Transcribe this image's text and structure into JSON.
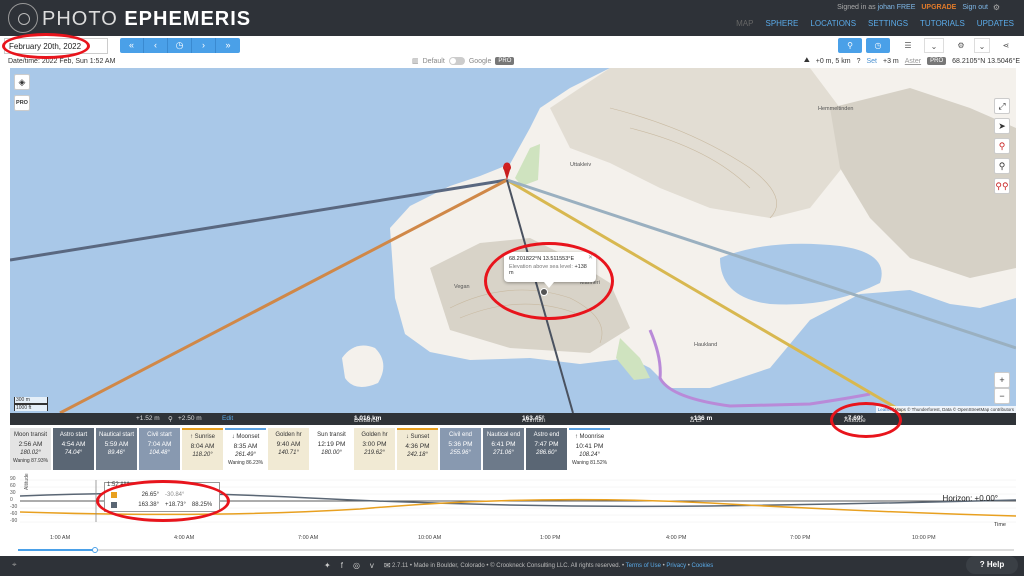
{
  "header": {
    "brand_part1": "PHOTO",
    "brand_part2": "EPHEMERIS",
    "signed_in_prefix": "Signed in as",
    "user_name": "johan FREE",
    "upgrade": "UPGRADE",
    "sign_out": "Sign out",
    "nav": [
      "MAP",
      "SPHERE",
      "LOCATIONS",
      "SETTINGS",
      "TUTORIALS",
      "UPDATES"
    ]
  },
  "toolbar": {
    "date": "February 20th, 2022",
    "nav_buttons": [
      "«",
      "‹",
      "◷",
      "›",
      "»"
    ]
  },
  "info": {
    "datetime": "Date/time: 2022 Feb, Sun 1:52 AM",
    "layer_default": "Default",
    "layer_google": "Google",
    "pro": "PRO",
    "elevation": "+0 m, 5 km",
    "set": "Set",
    "offset": "+3 m",
    "aster": "Aster",
    "coords": "68.2105°N 13.5046°E"
  },
  "map": {
    "popup_coords": "68.201822°N 13.511553°E",
    "popup_elev_label": "Elevation above sea level:",
    "popup_elev_value": "+138 m",
    "labels": {
      "uttakleiv": "Uttakleiv",
      "vegan": "Vegan",
      "manneri": "Manneri",
      "haukland": "Haukland",
      "hemmeltinden": "Hemmeltinden"
    },
    "scale_m": "300 m",
    "scale_ft": "1000 ft",
    "attribution_leaflet": "Leaflet",
    "attribution_rest": " | Maps © Thunderforest, Data © OpenStreetMap contributors",
    "pro_badge": "PRO"
  },
  "stats": {
    "height1": "+1.52 m",
    "height2": "+2.50 m",
    "edit": "Edit",
    "distance_label": "Distance",
    "distance_value": "1.016 km",
    "azimuth_label": "Azimuth",
    "azimuth_value": "163.45°",
    "del_label": "Δ El",
    "del_value": "+136 m",
    "altitude_label": "Altitude",
    "altitude_value": "+7.69°"
  },
  "events": [
    {
      "label": "Moon transit",
      "time": "2:56 AM",
      "az": "180.02°",
      "note": "Waning 87.93%",
      "style": "gray"
    },
    {
      "label": "Astro start",
      "time": "4:54 AM",
      "az": "74.04°",
      "note": "",
      "style": "dark"
    },
    {
      "label": "Nautical start",
      "time": "5:59 AM",
      "az": "89.46°",
      "note": "",
      "style": "slate"
    },
    {
      "label": "Civil start",
      "time": "7:04 AM",
      "az": "104.48°",
      "note": "",
      "style": "blue"
    },
    {
      "label": "↑ Sunrise",
      "time": "8:04 AM",
      "az": "118.20°",
      "note": "",
      "style": "cream-sun"
    },
    {
      "label": "↓ Moonset",
      "time": "8:35 AM",
      "az": "261.49°",
      "note": "Waning 86.23%",
      "style": "white-moon"
    },
    {
      "label": "Golden hr",
      "time": "9:40 AM",
      "az": "140.71°",
      "note": "",
      "style": "cream"
    },
    {
      "label": "Sun transit",
      "time": "12:19 PM",
      "az": "180.00°",
      "note": "",
      "style": "white"
    },
    {
      "label": "Golden hr",
      "time": "3:00 PM",
      "az": "219.62°",
      "note": "",
      "style": "cream"
    },
    {
      "label": "↓ Sunset",
      "time": "4:36 PM",
      "az": "242.18°",
      "note": "",
      "style": "cream-sun"
    },
    {
      "label": "Civil end",
      "time": "5:36 PM",
      "az": "255.96°",
      "note": "",
      "style": "blue"
    },
    {
      "label": "Nautical end",
      "time": "6:41 PM",
      "az": "271.06°",
      "note": "",
      "style": "slate"
    },
    {
      "label": "Astro end",
      "time": "7:47 PM",
      "az": "286.60°",
      "note": "",
      "style": "dark"
    },
    {
      "label": "↑ Moonrise",
      "time": "10:41 PM",
      "az": "108.24°",
      "note": "Waning 81.52%",
      "style": "white-moon"
    }
  ],
  "graph": {
    "y_ticks": [
      "90",
      "60",
      "30",
      "0",
      "-30",
      "-60",
      "-90"
    ],
    "y_label": "Altitude",
    "horizon": "Horizon: +0.00°",
    "time_label": "Time",
    "x_ticks": [
      "1:00 AM",
      "4:00 AM",
      "7:00 AM",
      "10:00 AM",
      "1:00 PM",
      "4:00 PM",
      "7:00 PM",
      "10:00 PM"
    ],
    "tooltip_time": "1:52 AM",
    "tooltip_sun_alt": "26.65°",
    "tooltip_sun_alt2": "-30.84°",
    "tooltip_moon_az": "163.38°",
    "tooltip_moon_alt": "+18.73°",
    "tooltip_moon_illum": "88.25%",
    "sun_color": "#e8a020",
    "moon_color": "#5a6674"
  },
  "footer": {
    "text": "2.7.11 • Made in Boulder, Colorado • © Crookneck Consulting LLC. All rights reserved. • ",
    "terms": "Terms of Use",
    "privacy": "Privacy",
    "cookies": "Cookies",
    "help": "Help"
  }
}
